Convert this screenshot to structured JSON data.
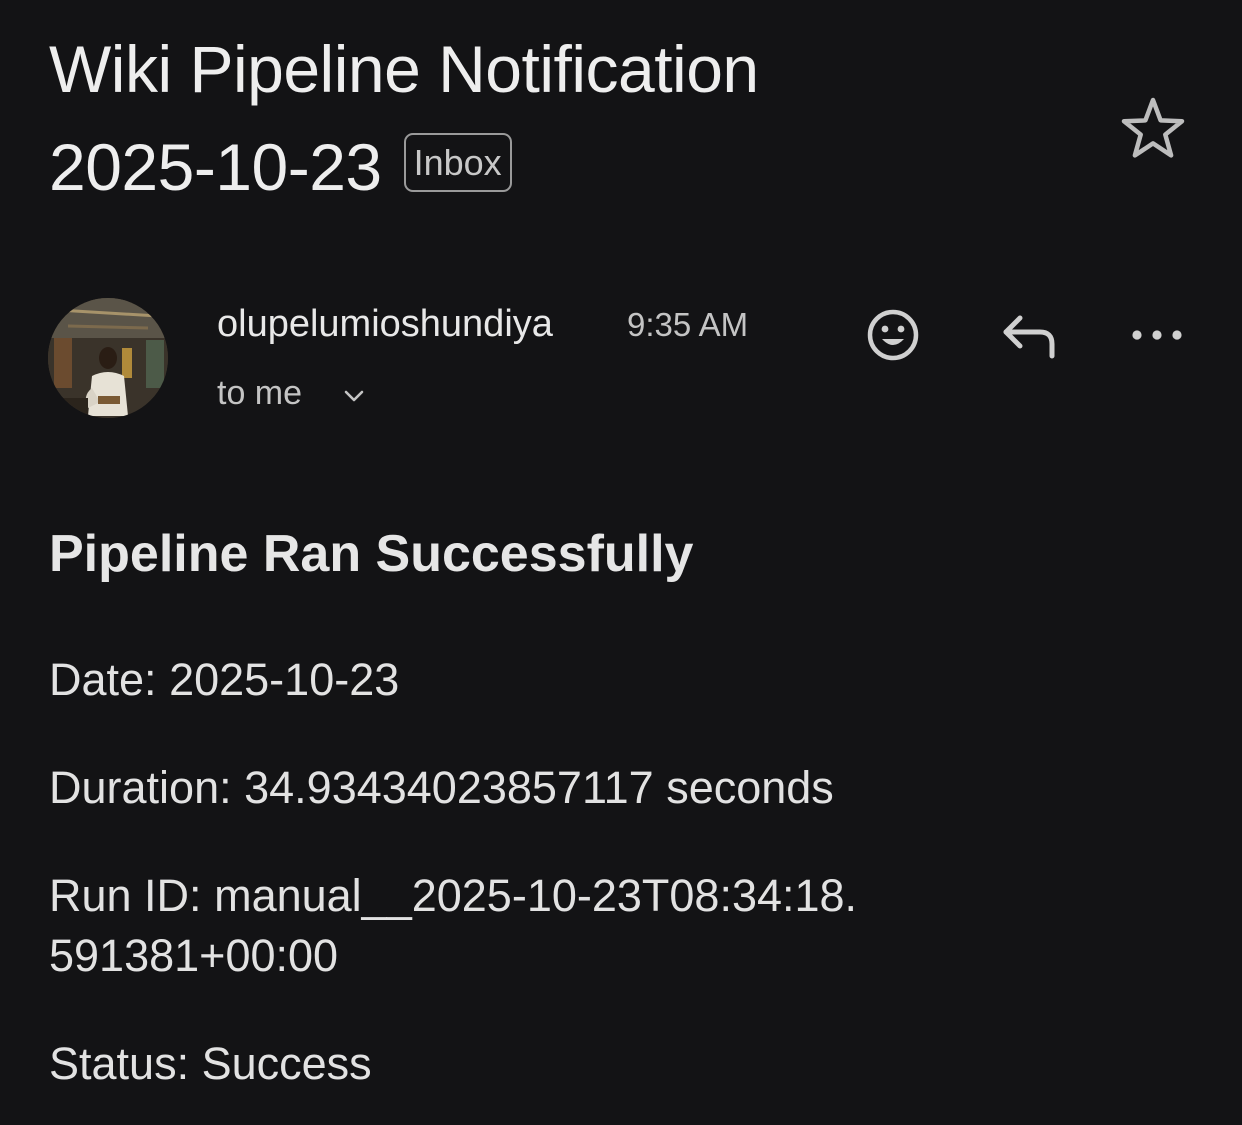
{
  "email": {
    "subject_line1": "Wiki Pipeline Notification",
    "subject_line2": "2025-10-23",
    "label_badge": "Inbox"
  },
  "sender": {
    "name": "olupelumioshundiya",
    "time": "9:35 AM",
    "recipients": "to me"
  },
  "icons": {
    "star": "star-outline-icon",
    "avatar": "avatar",
    "emoji": "emoji-reaction-icon",
    "reply": "reply-icon",
    "more": "more-options-icon",
    "chevron": "chevron-down-icon"
  },
  "body": {
    "heading": "Pipeline Ran Successfully",
    "date_label": "Date:",
    "date_value": "2025-10-23",
    "duration_label": "Duration:",
    "duration_value": "34.93434023857117 seconds",
    "run_id_label": "Run ID:",
    "run_id_value_part1": "manual__2025-10-23T08:34:18.",
    "run_id_value_part2": "591381+00:00",
    "status_label": "Status:",
    "status_value": "Success"
  },
  "colors": {
    "background": "#131315",
    "text": "#e3e3e3",
    "muted": "#c4c4c4"
  }
}
